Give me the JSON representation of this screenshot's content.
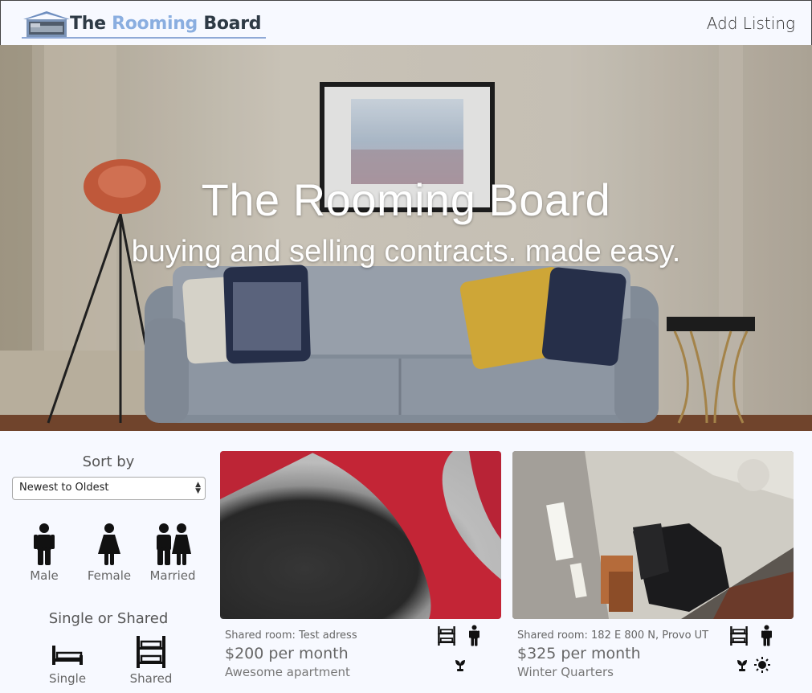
{
  "nav": {
    "brand_prefix": "The ",
    "brand_accent": "Rooming",
    "brand_suffix": " Board",
    "add_listing": "Add Listing"
  },
  "hero": {
    "title": "The Rooming Board",
    "subtitle": "buying and selling contracts. made easy."
  },
  "sidebar": {
    "sort_heading": "Sort by",
    "sort_value": "Newest to Oldest",
    "gender_filters": [
      {
        "label": "Male",
        "icon": "male-icon"
      },
      {
        "label": "Female",
        "icon": "female-icon"
      },
      {
        "label": "Married",
        "icon": "couple-icon"
      }
    ],
    "room_heading": "Single or Shared",
    "room_filters": [
      {
        "label": "Single",
        "icon": "single-bed-icon"
      },
      {
        "label": "Shared",
        "icon": "bunk-bed-icon"
      }
    ]
  },
  "listings": [
    {
      "address": "Shared room: Test adress",
      "price": "$200 per month",
      "description": "Awesome apartment",
      "icons": [
        "bunk-bed-icon",
        "male-icon",
        "plant-icon"
      ]
    },
    {
      "address": "Shared room: 182 E 800 N, Provo UT",
      "price": "$325 per month",
      "description": "Winter Quarters",
      "icons": [
        "bunk-bed-icon",
        "male-icon",
        "plant-icon",
        "sun-icon"
      ]
    }
  ],
  "colors": {
    "background": "#f7f9ff",
    "brand_accent": "#8aaee0",
    "brand_dark": "#2e3a45"
  }
}
